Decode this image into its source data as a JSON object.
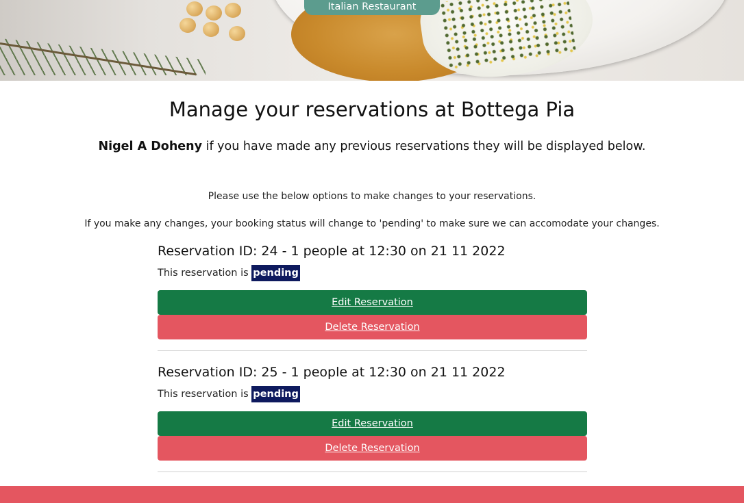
{
  "hero": {
    "tag_label": "Italian Restaurant"
  },
  "page": {
    "title": "Manage your reservations at Bottega Pia",
    "user_name": "Nigel A Doheny",
    "subtitle_rest": " if you have made any previous reservations they will be displayed below.",
    "info_line_1": "Please use the below options to make changes to your reservations.",
    "info_line_2": "If you make any changes, your booking status will change to 'pending' to make sure we can accomodate your changes."
  },
  "reservations": [
    {
      "heading": "Reservation ID: 24 - 1 people at 12:30 on 21 11 2022",
      "status_prefix": "This reservation is ",
      "status": "pending",
      "edit_label": "Edit Reservation",
      "delete_label": "Delete Reservation"
    },
    {
      "heading": "Reservation ID: 25 - 1 people at 12:30 on 21 11 2022",
      "status_prefix": "This reservation is ",
      "status": "pending",
      "edit_label": "Edit Reservation",
      "delete_label": "Delete Reservation"
    }
  ],
  "colors": {
    "edit_button": "#157a45",
    "delete_button": "#e45660",
    "status_badge": "#0e1a5e",
    "tag": "#5c9c8e",
    "footer": "#e45660"
  }
}
